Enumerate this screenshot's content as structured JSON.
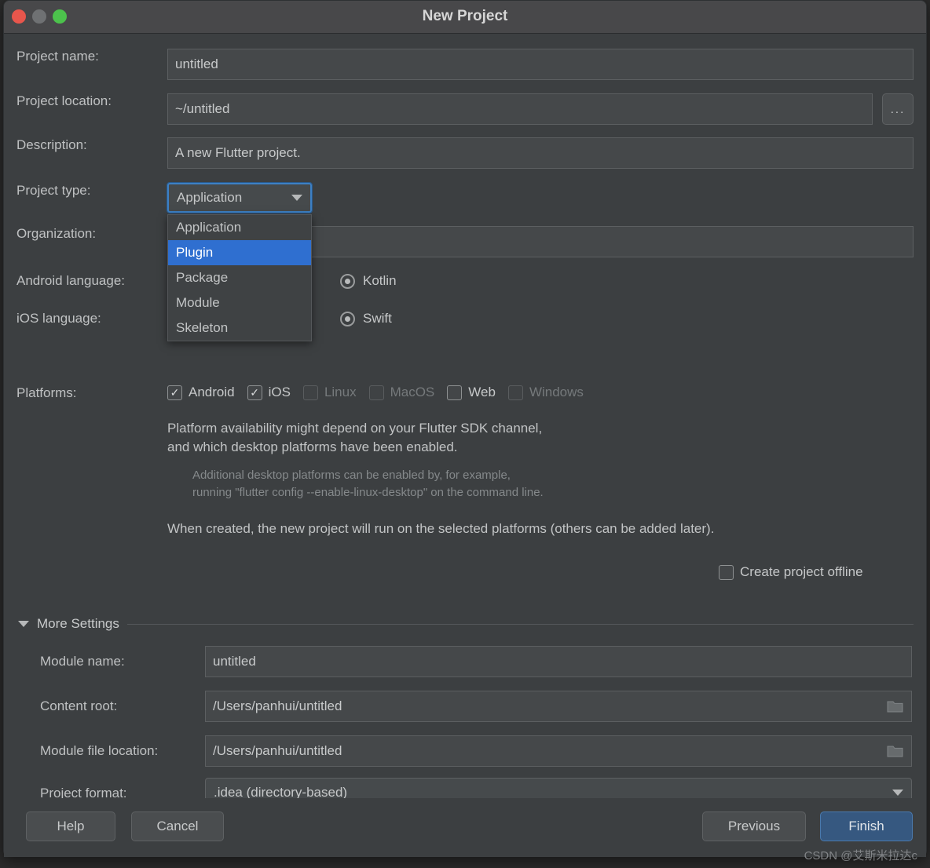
{
  "window": {
    "title": "New Project",
    "traffic_lights": [
      "close",
      "minimize",
      "zoom"
    ]
  },
  "form": {
    "project_name": {
      "label": "Project name:",
      "value": "untitled"
    },
    "project_location": {
      "label": "Project location:",
      "value": "~/untitled",
      "browse_label": "..."
    },
    "description": {
      "label": "Description:",
      "value": "A new Flutter project."
    },
    "project_type": {
      "label": "Project type:",
      "value": "Application",
      "options": [
        "Application",
        "Plugin",
        "Package",
        "Module",
        "Skeleton"
      ],
      "highlighted_option": "Plugin",
      "expanded": true
    },
    "organization": {
      "label": "Organization:",
      "value": ""
    },
    "android_language": {
      "label": "Android language:",
      "selected": "Kotlin",
      "options": [
        "Kotlin"
      ]
    },
    "ios_language": {
      "label": "iOS language:",
      "selected": "Swift",
      "options": [
        "Swift"
      ]
    },
    "platforms": {
      "label": "Platforms:",
      "items": [
        {
          "label": "Android",
          "checked": true,
          "enabled": true
        },
        {
          "label": "iOS",
          "checked": true,
          "enabled": true
        },
        {
          "label": "Linux",
          "checked": false,
          "enabled": false
        },
        {
          "label": "MacOS",
          "checked": false,
          "enabled": false
        },
        {
          "label": "Web",
          "checked": false,
          "enabled": true
        },
        {
          "label": "Windows",
          "checked": false,
          "enabled": false
        }
      ]
    },
    "notes": {
      "primary": "Platform availability might depend on your Flutter SDK channel,\nand which desktop platforms have been enabled.",
      "secondary": "Additional desktop platforms can be enabled by, for example,\nrunning \"flutter config --enable-linux-desktop\" on the command line.",
      "tertiary": "When created, the new project will run on the selected platforms (others can be added later)."
    },
    "create_offline": {
      "label": "Create project offline",
      "checked": false
    }
  },
  "more_settings": {
    "title": "More Settings",
    "expanded": true,
    "module_name": {
      "label": "Module name:",
      "value": "untitled"
    },
    "content_root": {
      "label": "Content root:",
      "value": "/Users/panhui/untitled"
    },
    "module_file_location": {
      "label": "Module file location:",
      "value": "/Users/panhui/untitled"
    },
    "project_format": {
      "label": "Project format:",
      "value": ".idea (directory-based)",
      "options": [
        ".idea (directory-based)"
      ]
    }
  },
  "footer": {
    "help": "Help",
    "cancel": "Cancel",
    "previous": "Previous",
    "finish": "Finish"
  },
  "watermark": "CSDN @艾斯米拉达c",
  "colors": {
    "window_bg": "#3c3f41",
    "titlebar_bg": "#48484a",
    "field_bg": "#45484a",
    "accent_blue": "#2f6fd0",
    "focus_border": "#3d80c4",
    "primary_button": "#365880",
    "close_dot": "#e8564c",
    "minimize_dot": "#6f7173",
    "zoom_dot": "#4cc24c"
  }
}
